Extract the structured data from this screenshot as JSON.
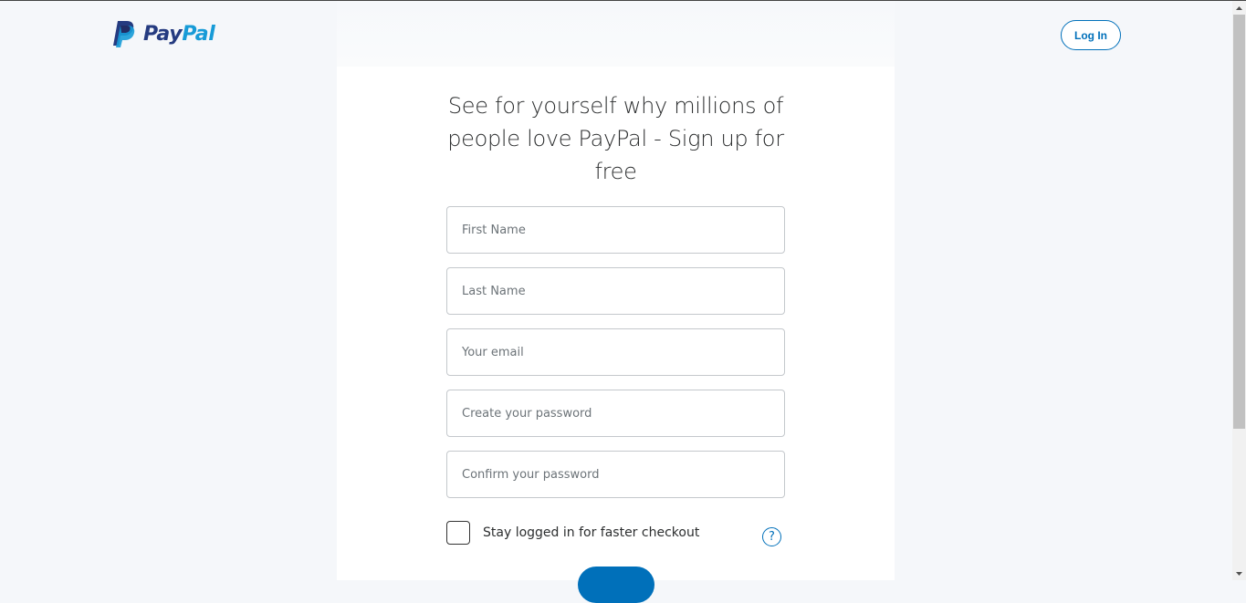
{
  "brand": {
    "logo_text_pay": "Pay",
    "logo_text_pal": "Pal",
    "colors": {
      "primary": "#0070ba",
      "dark_blue": "#253b80",
      "light_blue": "#179bd7"
    }
  },
  "header": {
    "login_label": "Log In"
  },
  "signup": {
    "headline": "See for yourself why millions of people love PayPal - Sign up for free",
    "first_name_placeholder": "First Name",
    "last_name_placeholder": "Last Name",
    "email_placeholder": "Your email",
    "password_placeholder": "Create your password",
    "confirm_password_placeholder": "Confirm your password",
    "stay_logged_in_label": "Stay logged in for faster checkout",
    "help_icon_glyph": "?",
    "stay_logged_in_checked": false
  },
  "icons": [
    "paypal-logo-icon",
    "help-icon",
    "scroll-up-arrow-icon",
    "scroll-down-arrow-icon"
  ]
}
